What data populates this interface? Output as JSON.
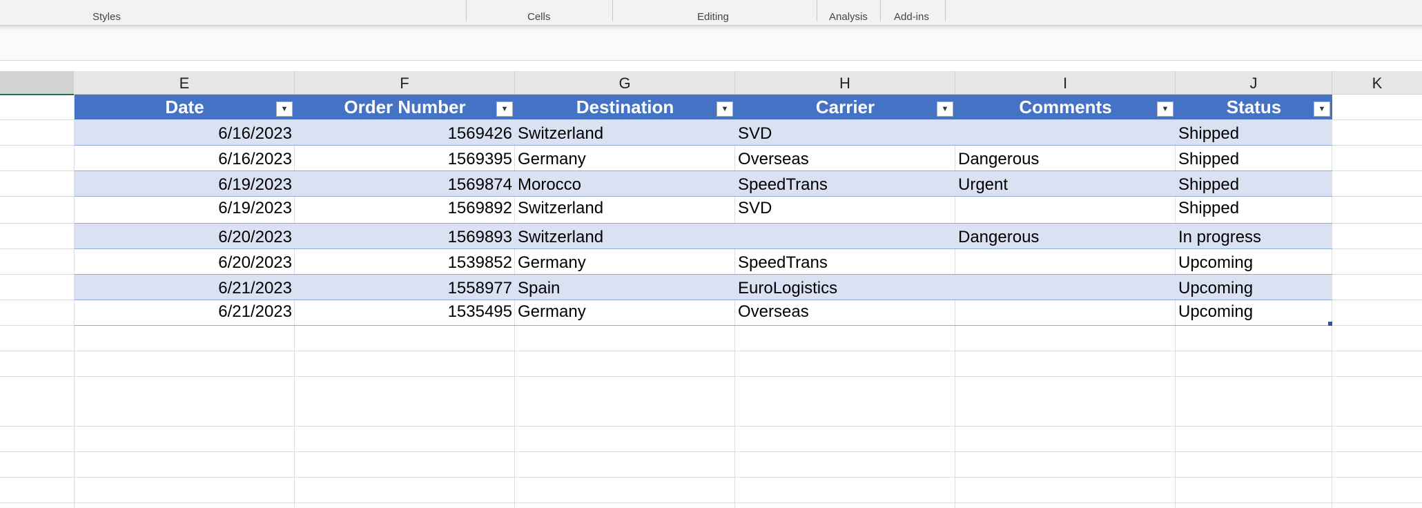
{
  "ribbon": {
    "groups": [
      {
        "label": "Styles"
      },
      {
        "label": "Cells"
      },
      {
        "label": "Editing"
      },
      {
        "label": "Analysis"
      },
      {
        "label": "Add-ins"
      }
    ]
  },
  "columns": [
    "E",
    "F",
    "G",
    "H",
    "I",
    "J",
    "K"
  ],
  "table": {
    "headers": [
      "Date",
      "Order Number",
      "Destination",
      "Carrier",
      "Comments",
      "Status"
    ],
    "rows": [
      {
        "date": "6/16/2023",
        "order": "1569426",
        "destination": "Switzerland",
        "carrier": "SVD",
        "comments": "",
        "status": "Shipped"
      },
      {
        "date": "6/16/2023",
        "order": "1569395",
        "destination": "Germany",
        "carrier": "Overseas",
        "comments": "Dangerous",
        "status": "Shipped"
      },
      {
        "date": "6/19/2023",
        "order": "1569874",
        "destination": "Morocco",
        "carrier": "SpeedTrans",
        "comments": "Urgent",
        "status": "Shipped"
      },
      {
        "date": "6/19/2023",
        "order": "1569892",
        "destination": "Switzerland",
        "carrier": "SVD",
        "comments": "",
        "status": "Shipped"
      },
      {
        "date": "6/20/2023",
        "order": "1569893",
        "destination": "Switzerland",
        "carrier": "",
        "comments": "Dangerous",
        "status": "In progress"
      },
      {
        "date": "6/20/2023",
        "order": "1539852",
        "destination": "Germany",
        "carrier": "SpeedTrans",
        "comments": "",
        "status": "Upcoming"
      },
      {
        "date": "6/21/2023",
        "order": "1558977",
        "destination": "Spain",
        "carrier": "EuroLogistics",
        "comments": "",
        "status": "Upcoming"
      },
      {
        "date": "6/21/2023",
        "order": "1535495",
        "destination": "Germany",
        "carrier": "Overseas",
        "comments": "",
        "status": "Upcoming"
      }
    ]
  },
  "colors": {
    "header_fill": "#4472c4",
    "band_fill": "#d9e1f2",
    "header_text": "#ffffff"
  }
}
